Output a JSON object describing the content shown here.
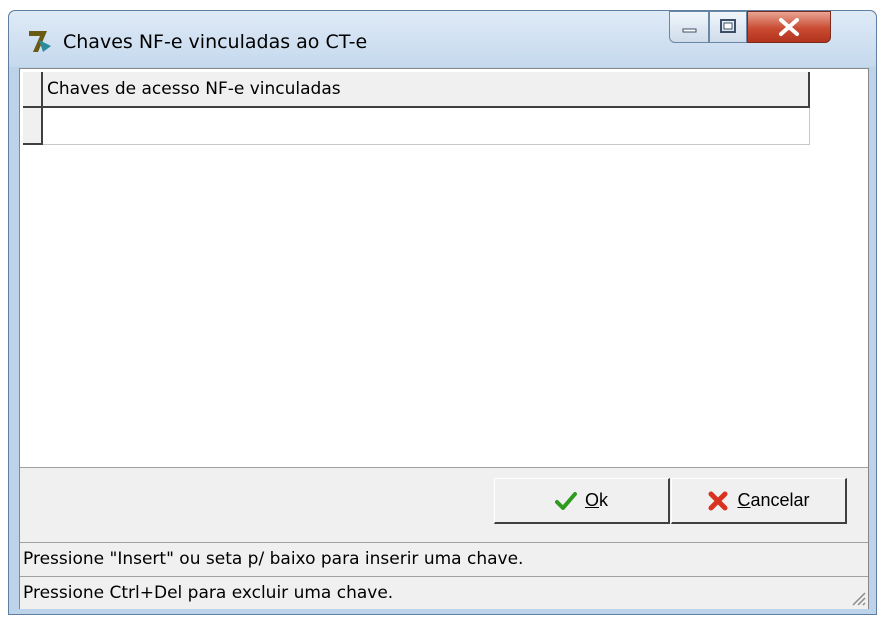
{
  "window": {
    "title": "Chaves NF-e vinculadas ao CT-e",
    "app_icon": "app-logo-icon",
    "controls": [
      "minimize-icon",
      "maximize-icon",
      "close-icon"
    ]
  },
  "grid": {
    "columns": [
      "Chaves de acesso NF-e vinculadas"
    ],
    "rows": [
      [
        ""
      ]
    ]
  },
  "buttons": {
    "ok": {
      "underlined": "O",
      "rest": "k",
      "icon": "checkmark-icon",
      "icon_color": "#2e9a1e"
    },
    "cancel": {
      "underlined": "C",
      "rest": "ancelar",
      "icon": "x-icon",
      "icon_color": "#d9331f"
    }
  },
  "status": {
    "line1": "Pressione \"Insert\" ou seta p/ baixo para inserir uma chave.",
    "line2": "Pressione Ctrl+Del para excluir uma chave."
  }
}
